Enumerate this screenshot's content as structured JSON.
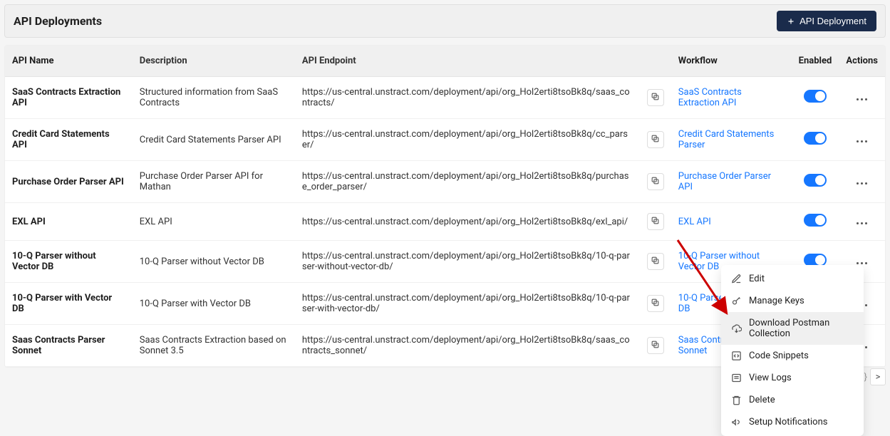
{
  "page": {
    "title": "API Deployments",
    "new_button_label": "API Deployment"
  },
  "columns": {
    "name": "API Name",
    "description": "Description",
    "endpoint": "API Endpoint",
    "workflow": "Workflow",
    "enabled": "Enabled",
    "actions": "Actions"
  },
  "rows": [
    {
      "name": "SaaS Contracts Extraction API",
      "description": "Structured information from SaaS Contracts",
      "endpoint": "https://us-central.unstract.com/deployment/api/org_Hol2erti8tsoBk8q/saas_contracts/",
      "workflow": "SaaS Contracts Extraction API",
      "enabled": true
    },
    {
      "name": "Credit Card Statements API",
      "description": "Credit Card Statements Parser API",
      "endpoint": "https://us-central.unstract.com/deployment/api/org_Hol2erti8tsoBk8q/cc_parser/",
      "workflow": "Credit Card Statements Parser",
      "enabled": true
    },
    {
      "name": "Purchase Order Parser API",
      "description": "Purchase Order Parser API for Mathan",
      "endpoint": "https://us-central.unstract.com/deployment/api/org_Hol2erti8tsoBk8q/purchase_order_parser/",
      "workflow": "Purchase Order Parser API",
      "enabled": true
    },
    {
      "name": "EXL API",
      "description": "EXL API",
      "endpoint": "https://us-central.unstract.com/deployment/api/org_Hol2erti8tsoBk8q/exl_api/",
      "workflow": "EXL API",
      "enabled": true
    },
    {
      "name": "10-Q Parser without Vector DB",
      "description": "10-Q Parser without Vector DB",
      "endpoint": "https://us-central.unstract.com/deployment/api/org_Hol2erti8tsoBk8q/10-q-parser-without-vector-db/",
      "workflow": "10-Q Parser without Vector DB",
      "enabled": true
    },
    {
      "name": "10-Q Parser with Vector DB",
      "description": "10-Q Parser with Vector DB",
      "endpoint": "https://us-central.unstract.com/deployment/api/org_Hol2erti8tsoBk8q/10-q-parser-with-vector-db/",
      "workflow": "10-Q Parser with Vector DB",
      "enabled": true
    },
    {
      "name": "Saas Contracts Parser Sonnet",
      "description": "Saas Contracts Extraction based on Sonnet 3.5",
      "endpoint": "https://us-central.unstract.com/deployment/api/org_Hol2erti8tsoBk8q/saas_contracts_sonnet/",
      "workflow": "Saas Contracts Parser Sonnet",
      "enabled": true
    }
  ],
  "actions_menu": {
    "edit": "Edit",
    "manage_keys": "Manage Keys",
    "download_postman": "Download Postman Collection",
    "code_snippets": "Code Snippets",
    "view_logs": "View Logs",
    "delete": "Delete",
    "setup_notifications": "Setup Notifications"
  },
  "pagination_fragment": {
    "close_brace": "}",
    "caret": ">"
  }
}
